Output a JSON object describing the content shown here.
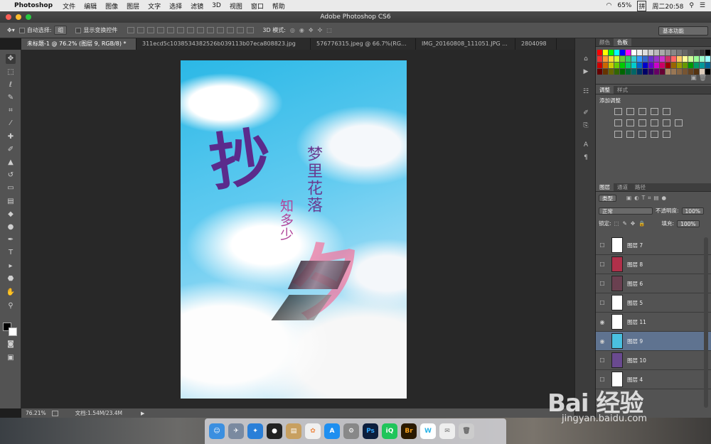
{
  "menubar": {
    "app": "Photoshop",
    "items": [
      "文件",
      "编辑",
      "图像",
      "图层",
      "文字",
      "选择",
      "滤镜",
      "3D",
      "视图",
      "窗口",
      "帮助"
    ],
    "battery": "65%",
    "input": "拼",
    "clock": "周二20:58"
  },
  "window": {
    "title": "Adobe Photoshop CS6"
  },
  "options": {
    "auto_select": "自动选择:",
    "group": "组",
    "show_transform": "显示变换控件",
    "mode_3d": "3D 模式:",
    "workspace": "基本功能"
  },
  "tabs": [
    "未标题-1 @ 76.2% (图层 9, RGB/8) *",
    "311ecd5c1038534382526b039113b07eca808823.jpg",
    "576776315.jpeg @ 66.7%(RG...",
    "IMG_20160808_111051.JPG ...",
    "2804098"
  ],
  "poster": {
    "big1": "抄",
    "big2": "夕",
    "line1": "梦里花落",
    "line2": "知多少"
  },
  "status": {
    "zoom": "76.21%",
    "doc": "文档:1.54M/23.4M"
  },
  "panels": {
    "color_tab": "颜色",
    "swatch_tab": "色板",
    "adjust_tab": "调整",
    "style_tab": "样式",
    "add_adjust": "添加调整",
    "layers_tab": "图层",
    "channels_tab": "通道",
    "paths_tab": "路径",
    "kind": "类型",
    "blend": "正常",
    "opacity_label": "不透明度:",
    "opacity": "100%",
    "lock": "锁定:",
    "fill_label": "填充:",
    "fill": "100%"
  },
  "layers": [
    {
      "name": "图层 7",
      "visible": false
    },
    {
      "name": "图层 8",
      "visible": false
    },
    {
      "name": "图层 6",
      "visible": false
    },
    {
      "name": "图层 5",
      "visible": false
    },
    {
      "name": "图层 11",
      "visible": true
    },
    {
      "name": "图层 9",
      "visible": true,
      "active": true
    },
    {
      "name": "图层 10",
      "visible": false
    },
    {
      "name": "图层 4",
      "visible": false
    }
  ],
  "dock": [
    "Finder",
    "Launchpad",
    "Safari",
    "QQ",
    "Preview",
    "Photos",
    "App Store",
    "Settings",
    "Ps",
    "iQIYI",
    "Br",
    "W",
    "Mail",
    "Trash"
  ],
  "watermark": {
    "logo": "Bai 经验",
    "url": "jingyan.baidu.com"
  }
}
